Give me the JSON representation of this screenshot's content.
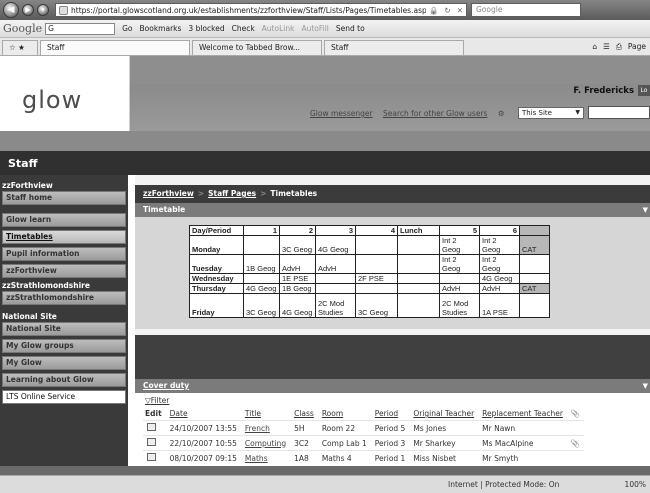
{
  "browser": {
    "url": "https://portal.glowscotland.org.uk/establishments/zzforthview/Staff/Lists/Pages/Timetables.aspx",
    "search_placeholder": "Google",
    "google_label": "Google",
    "google_input": "G",
    "toolbar": [
      "Go",
      "Bookmarks",
      "3 blocked",
      "Check",
      "AutoLink",
      "AutoFill",
      "Send to"
    ],
    "tabs": [
      "Staff",
      "Welcome to Tabbed Brow...",
      "Staff"
    ],
    "tab_tools": [
      "Page"
    ],
    "status_zone": "Internet | Protected Mode: On",
    "status_zoom": "100%"
  },
  "header": {
    "logo": "glow",
    "user": "F. Fredericks",
    "user_badge": "Lo",
    "links": [
      "Glow messenger",
      "Search for other Glow users"
    ],
    "scope_option": "This Site",
    "site_title": "Staff"
  },
  "sidebar": [
    {
      "type": "heading",
      "label": "zzForthview"
    },
    {
      "type": "item",
      "label": "Staff home"
    },
    {
      "type": "gap"
    },
    {
      "type": "item",
      "label": "Glow learn"
    },
    {
      "type": "item",
      "label": "Timetables",
      "current": true
    },
    {
      "type": "item",
      "label": "Pupil information"
    },
    {
      "type": "item",
      "label": "zzForthview"
    },
    {
      "type": "heading",
      "label": "zzStrathlomondshire"
    },
    {
      "type": "item",
      "label": "zzStrathlomondshire"
    },
    {
      "type": "gap"
    },
    {
      "type": "heading",
      "label": "National Site"
    },
    {
      "type": "item",
      "label": "National Site"
    },
    {
      "type": "item",
      "label": "My Glow groups"
    },
    {
      "type": "item",
      "label": "My Glow"
    },
    {
      "type": "item",
      "label": "Learning about Glow"
    },
    {
      "type": "item",
      "label": "LTS Online Service",
      "white": true
    }
  ],
  "breadcrumb": [
    "zzForthview",
    "Staff Pages",
    "Timetables"
  ],
  "timetable": {
    "title": "Timetable",
    "header": [
      "Day/Period",
      "1",
      "2",
      "3",
      "4",
      "Lunch",
      "5",
      "6",
      ""
    ],
    "rows": [
      [
        "Monday",
        "",
        "3C Geog",
        "4G Geog",
        "",
        "",
        "Int 2 Geog",
        "Int 2 Geog",
        "CAT"
      ],
      [
        "Tuesday",
        "1B Geog",
        "AdvH",
        "AdvH",
        "",
        "",
        "Int 2 Geog",
        "Int 2 Geog",
        ""
      ],
      [
        "Wednesday",
        "",
        "1E PSE",
        "",
        "2F PSE",
        "",
        "",
        "4G Geog",
        ""
      ],
      [
        "Thursday",
        "4G Geog",
        "1B Geog",
        "",
        "",
        "",
        "AdvH",
        "AdvH",
        "CAT"
      ],
      [
        "Friday",
        "3C Geog",
        "4G Geog",
        "2C Mod Studies",
        "3C Geog",
        "",
        "2C Mod Studies",
        "1A PSE",
        ""
      ]
    ]
  },
  "cover_duty": {
    "title": "Cover duty",
    "filter": "Filter",
    "columns": [
      "Edit",
      "Date",
      "Title",
      "Class",
      "Room",
      "Period",
      "Original Teacher",
      "Replacement Teacher"
    ],
    "rows": [
      {
        "date": "24/10/2007 13:55",
        "title": "French",
        "class": "5H",
        "room": "Room 22",
        "period": "Period 5",
        "original": "Ms Jones",
        "replacement": "Mr Nawn"
      },
      {
        "date": "22/10/2007 10:55",
        "title": "Computing",
        "class": "3C2",
        "room": "Comp Lab 1",
        "period": "Period 3",
        "original": "Mr Sharkey",
        "replacement": "Ms MacAlpine"
      },
      {
        "date": "08/10/2007 09:15",
        "title": "Maths",
        "class": "1A8",
        "room": "Maths 4",
        "period": "Period 1",
        "original": "Miss Nisbet",
        "replacement": "Mr Smyth"
      }
    ]
  }
}
